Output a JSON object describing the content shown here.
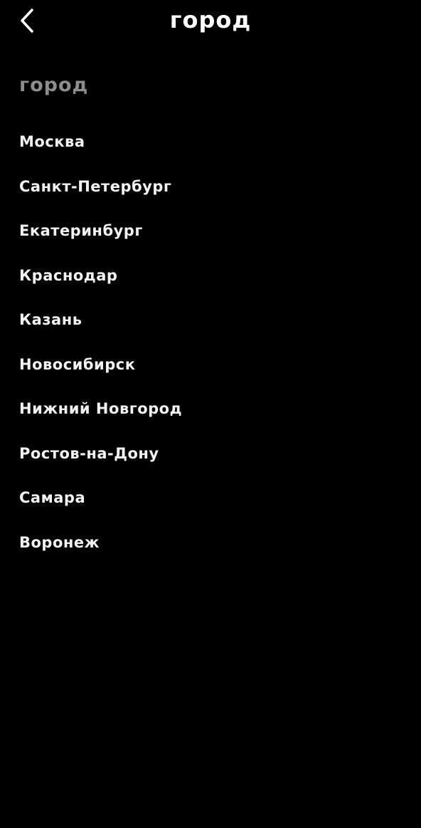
{
  "header": {
    "back_icon": "chevron-left-icon",
    "title": "город"
  },
  "section": {
    "title": "город"
  },
  "cities": [
    {
      "label": "Москва"
    },
    {
      "label": "Санкт-Петербург"
    },
    {
      "label": "Екатеринбург"
    },
    {
      "label": "Краснодар"
    },
    {
      "label": "Казань"
    },
    {
      "label": "Новосибирск"
    },
    {
      "label": "Нижний Новгород"
    },
    {
      "label": "Ростов-на-Дону"
    },
    {
      "label": "Самара"
    },
    {
      "label": "Воронеж"
    }
  ],
  "colors": {
    "background": "#000000",
    "text": "#ffffff",
    "section_title": "#8d8d8d"
  }
}
